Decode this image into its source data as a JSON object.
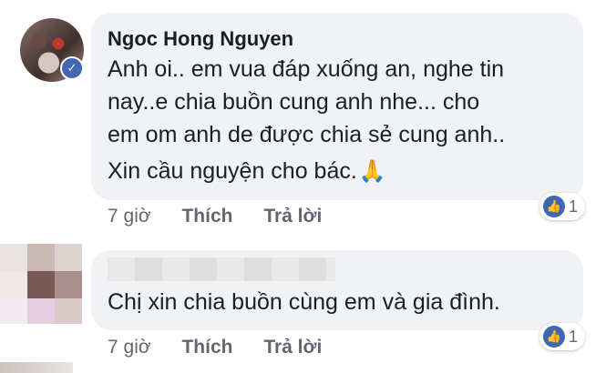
{
  "comments": [
    {
      "author": "Ngoc Hong Nguyen",
      "lines": [
        "Anh oi.. em vua đáp xuống an, nghe tin",
        "nay..e chia buồn cung anh nhe... cho",
        "em om anh de được chia sẻ cung anh..",
        "Xin cầu nguyện cho bác."
      ],
      "emoji": "🙏",
      "time": "7 giờ",
      "like_label": "Thích",
      "reply_label": "Trả lời",
      "reaction_icon": "like-icon",
      "reaction_count": "1"
    },
    {
      "author": "",
      "lines": [
        "Chị xin chia buồn cùng em và gia đình."
      ],
      "time": "7 giờ",
      "like_label": "Thích",
      "reply_label": "Trả lời",
      "reaction_icon": "like-icon",
      "reaction_count": "1"
    }
  ],
  "colors": {
    "bubble": "#f0f2f5",
    "facebook_blue": "#4267b2",
    "meta_text": "#606770"
  }
}
